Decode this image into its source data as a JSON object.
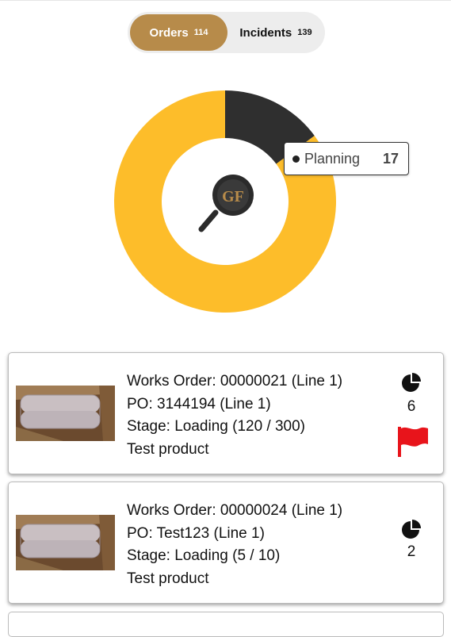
{
  "tabs": [
    {
      "label": "Orders",
      "count": "114"
    },
    {
      "label": "Incidents",
      "count": "139"
    }
  ],
  "chart_data": {
    "type": "pie",
    "donut": true,
    "series": [
      {
        "name": "Planning",
        "value": 17
      },
      {
        "value": 97
      }
    ],
    "colors": [
      "#2f2f2f",
      "#fdbd2a"
    ],
    "tooltip": {
      "label": "Planning",
      "value": "17"
    },
    "center_logo_text": "GF"
  },
  "orders": [
    {
      "works_order": "Works Order: 00000021 (Line 1)",
      "po": "PO: 3144194 (Line 1)",
      "stage": "Stage: Loading (120 / 300)",
      "product": "Test product",
      "count": "6",
      "flagged": true
    },
    {
      "works_order": "Works Order: 00000024 (Line 1)",
      "po": "PO: Test123 (Line 1)",
      "stage": "Stage: Loading (5 / 10)",
      "product": "Test product",
      "count": "2",
      "flagged": false
    }
  ],
  "colors": {
    "accent": "#b78b4a",
    "flag": "#e8141b",
    "chart_major": "#fdbd2a",
    "chart_minor": "#2f2f2f"
  }
}
